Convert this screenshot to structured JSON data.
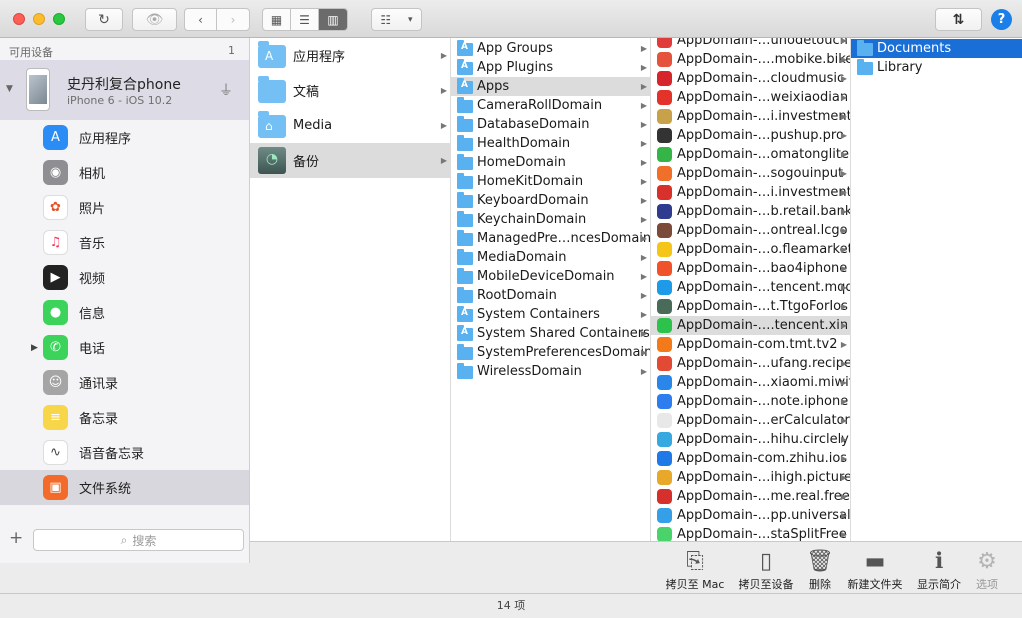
{
  "sidebar": {
    "heading": "可用设备",
    "count": "1",
    "device": {
      "name": "史丹利复合phone",
      "subtitle": "iPhone 6 - iOS 10.2"
    },
    "items": [
      {
        "label": "应用程序",
        "icon": "app-store-icon",
        "color": "#2b8cf5"
      },
      {
        "label": "相机",
        "icon": "camera-icon",
        "color": "#8e8e93"
      },
      {
        "label": "照片",
        "icon": "photos-icon",
        "color": "#ffffff"
      },
      {
        "label": "音乐",
        "icon": "music-icon",
        "color": "#ffffff"
      },
      {
        "label": "视频",
        "icon": "video-icon",
        "color": "#222222"
      },
      {
        "label": "信息",
        "icon": "messages-icon",
        "color": "#3bd35a"
      },
      {
        "label": "电话",
        "icon": "phone-icon",
        "color": "#3bd35a"
      },
      {
        "label": "通讯录",
        "icon": "contacts-icon",
        "color": "#a5a5a5"
      },
      {
        "label": "备忘录",
        "icon": "notes-icon",
        "color": "#f8d649"
      },
      {
        "label": "语音备忘录",
        "icon": "voice-memo-icon",
        "color": "#ffffff"
      },
      {
        "label": "文件系统",
        "icon": "filesystem-icon",
        "color": "#f26b2a"
      }
    ],
    "search_placeholder": "搜索",
    "add_label": "+"
  },
  "columns": {
    "col1": [
      {
        "label": "应用程序",
        "icon": "A"
      },
      {
        "label": "文稿",
        "icon": ""
      },
      {
        "label": "Media",
        "icon": ""
      },
      {
        "label": "备份",
        "icon": "backup"
      }
    ],
    "col2": [
      {
        "label": "App Groups",
        "a": true
      },
      {
        "label": "App Plugins",
        "a": true
      },
      {
        "label": "Apps",
        "a": true
      },
      {
        "label": "CameraRollDomain"
      },
      {
        "label": "DatabaseDomain"
      },
      {
        "label": "HealthDomain"
      },
      {
        "label": "HomeDomain"
      },
      {
        "label": "HomeKitDomain"
      },
      {
        "label": "KeyboardDomain"
      },
      {
        "label": "KeychainDomain"
      },
      {
        "label": "ManagedPre…ncesDomain"
      },
      {
        "label": "MediaDomain"
      },
      {
        "label": "MobileDeviceDomain"
      },
      {
        "label": "RootDomain"
      },
      {
        "label": "System Containers",
        "a": true
      },
      {
        "label": "System Shared Containers",
        "a": true
      },
      {
        "label": "SystemPreferencesDomain"
      },
      {
        "label": "WirelessDomain"
      }
    ],
    "col3": [
      {
        "label": "AppDomain-…uhodetouch",
        "color": "#e03b3b"
      },
      {
        "label": "AppDomain-….mobike.bike",
        "color": "#e5533d"
      },
      {
        "label": "AppDomain-…cloudmusic",
        "color": "#d6252b"
      },
      {
        "label": "AppDomain-…weixiaodian",
        "color": "#e2322a"
      },
      {
        "label": "AppDomain-…i.investment",
        "color": "#c8a24a"
      },
      {
        "label": "AppDomain-…pushup.pro",
        "color": "#333333"
      },
      {
        "label": "AppDomain-…omatonglite",
        "color": "#35b548"
      },
      {
        "label": "AppDomain-…sogouinput",
        "color": "#f0702a"
      },
      {
        "label": "AppDomain-…i.investment",
        "color": "#d8302a"
      },
      {
        "label": "AppDomain-…b.retail.bank",
        "color": "#2f3b8f"
      },
      {
        "label": "AppDomain-…ontreal.lcgo",
        "color": "#7a4b3a"
      },
      {
        "label": "AppDomain-…o.fleamarket",
        "color": "#f5c518"
      },
      {
        "label": "AppDomain-…bao4iphone",
        "color": "#f0522a"
      },
      {
        "label": "AppDomain-…tencent.mqq",
        "color": "#1e9be8"
      },
      {
        "label": "AppDomain-…t.TtgoForIos",
        "color": "#4a6a5a"
      },
      {
        "label": "AppDomain-….tencent.xin",
        "color": "#2dc24b"
      },
      {
        "label": "AppDomain-com.tmt.tv2",
        "color": "#f27a1a"
      },
      {
        "label": "AppDomain-…ufang.recipe",
        "color": "#e34a33"
      },
      {
        "label": "AppDomain-…xiaomi.miwifi",
        "color": "#2a86e8"
      },
      {
        "label": "AppDomain-…note.iphone",
        "color": "#2e7df0"
      },
      {
        "label": "AppDomain-…erCalculator",
        "color": "#e8e8e8"
      },
      {
        "label": "AppDomain-…hihu.circlely",
        "color": "#36a9e1"
      },
      {
        "label": "AppDomain-com.zhihu.ios",
        "color": "#1f7ae8"
      },
      {
        "label": "AppDomain-…ihigh.picture",
        "color": "#e8a92a"
      },
      {
        "label": "AppDomain-…me.real.free",
        "color": "#d6302c"
      },
      {
        "label": "AppDomain-…pp.universal",
        "color": "#35a0e8"
      },
      {
        "label": "AppDomain-…staSplitFree",
        "color": "#4ad36a"
      }
    ],
    "col4": [
      {
        "label": "Documents"
      },
      {
        "label": "Library"
      }
    ]
  },
  "actions": [
    {
      "label": "拷贝至 Mac",
      "icon": "copy-to-mac-icon",
      "glyph": "⎘",
      "enabled": true
    },
    {
      "label": "拷贝至设备",
      "icon": "copy-to-device-icon",
      "glyph": "▯",
      "enabled": true
    },
    {
      "label": "删除",
      "icon": "trash-icon",
      "glyph": "🗑",
      "enabled": true
    },
    {
      "label": "新建文件夹",
      "icon": "new-folder-icon",
      "glyph": "▬",
      "enabled": true
    },
    {
      "label": "显示简介",
      "icon": "info-icon",
      "glyph": "ℹ",
      "enabled": true
    },
    {
      "label": "选项",
      "icon": "gear-icon",
      "glyph": "⚙",
      "enabled": false
    }
  ],
  "status": "14 项"
}
